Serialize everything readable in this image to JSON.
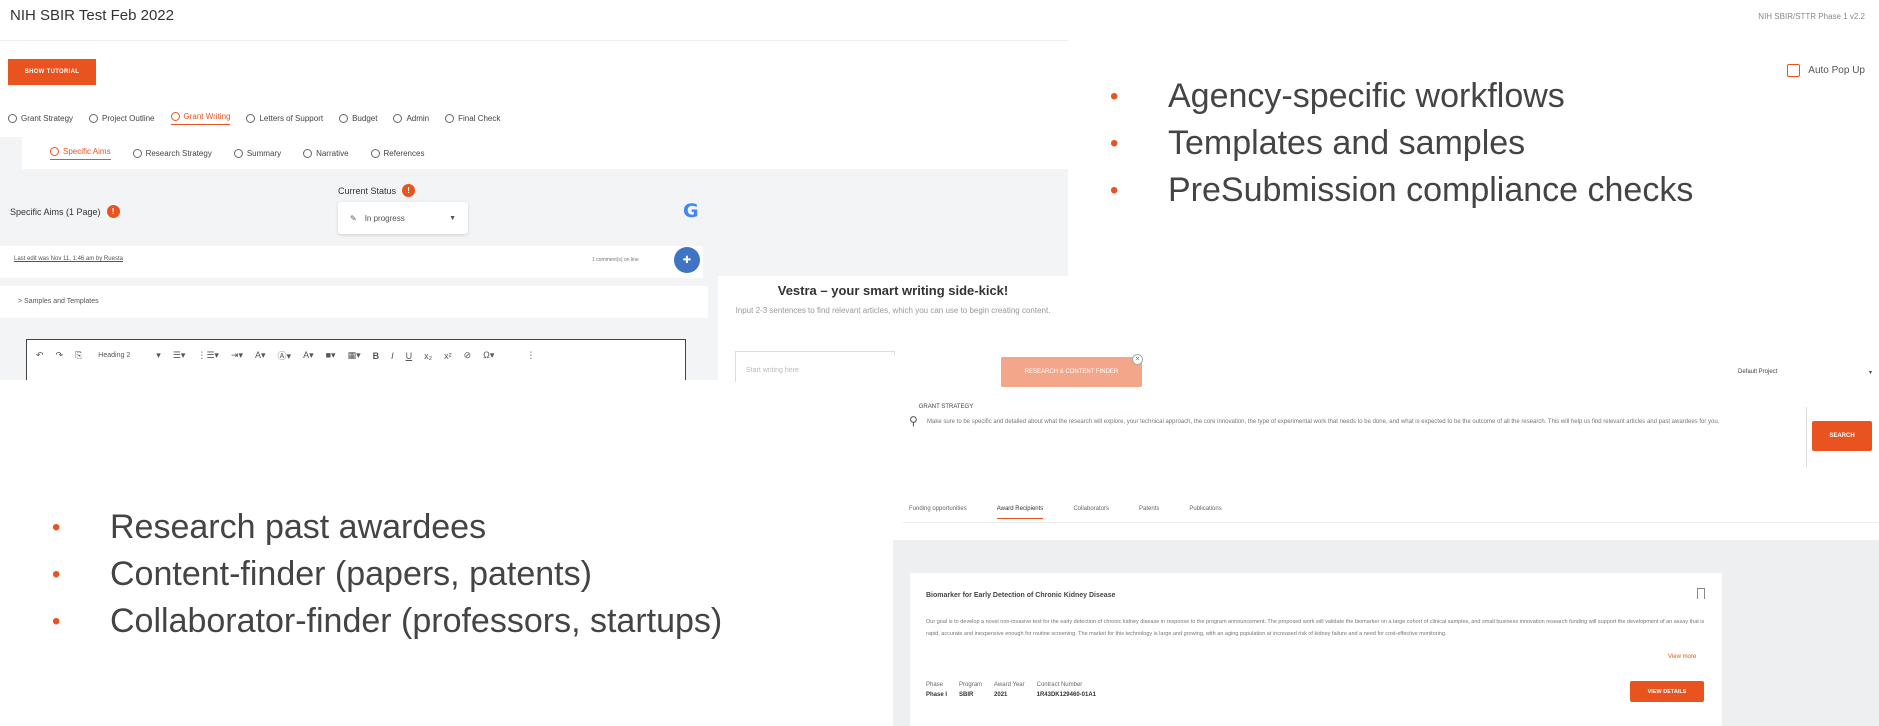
{
  "app": {
    "title": "NIH SBIR Test Feb 2022",
    "phase_label": "NIH SBIR/STTR Phase 1 v2.2",
    "show_tutorial_label": "SHOW TUTORIAL",
    "auto_popup_label": "Auto Pop Up",
    "main_tabs": [
      "Grant Strategy",
      "Project Outline",
      "Grant Writing",
      "Letters of Support",
      "Budget",
      "Admin",
      "Final Check"
    ],
    "sub_tabs": [
      "Specific Aims",
      "Research Strategy",
      "Summary",
      "Narrative",
      "References"
    ],
    "specific_aims_label": "Specific Aims (1 Page)",
    "info_mark": "!",
    "current_status_label": "Current Status",
    "status_value": "In progress",
    "last_edit_text": "Last edit was Nov 11, 1:46 am by Ruesta",
    "comments_count": "1 comment(s) on line",
    "samples_label": "> Samples and Templates",
    "toolbar_heading": "Heading 2",
    "vestra_title": "Vestra – your smart writing side-kick!",
    "vestra_sub": "Input 2-3 sentences to find relevant articles, which you can use to begin creating content.",
    "start_writing_placeholder": "Start writing here"
  },
  "bullets_right": [
    "Agency-specific workflows",
    "Templates and samples",
    "PreSubmission compliance checks"
  ],
  "bullets_left": [
    "Research past awardees",
    "Content-finder (papers, patents)",
    "Collaborator-finder (professors, startups)"
  ],
  "research": {
    "tab_strategy": "GRANT STRATEGY",
    "tab_active": "RESEARCH & CONTENT FINDER",
    "select_value": "Default Project",
    "search_text": "Make sure to be specific and detailed about what the research will explore, your technical approach, the core innovation, the type of experimental work that needs to be done, and what is expected to be the outcome of all the research. This will help us find relevant articles and past awardees for you.",
    "search_button": "SEARCH",
    "tabs": [
      "Funding opportunities",
      "Award Recipients",
      "Collaborators",
      "Patents",
      "Publications"
    ],
    "card_title": "Biomarker for Early Detection of Chronic Kidney Disease",
    "card_body": "Our goal is to develop a novel non-invasive test for the early detection of chronic kidney disease in response to the program announcement. The proposed work will validate the biomarker on a large cohort of clinical samples, and small business innovation research funding will support the development of an assay that is rapid, accurate and inexpensive enough for routine screening. The market for this technology is large and growing, with an aging population at increased risk of kidney failure and a need for cost-effective monitoring.",
    "view_more": "View more",
    "meta_headers": [
      "Phase",
      "Program",
      "Award Year",
      "Contract Number"
    ],
    "meta_values": [
      "Phase I",
      "SBIR",
      "2021",
      "1R43DK129460-01A1"
    ],
    "view_details": "VIEW DETAILS"
  },
  "colors": {
    "accent": "#e8531f",
    "accent_light": "#f4a68a",
    "fab_blue": "#3f73c4"
  }
}
